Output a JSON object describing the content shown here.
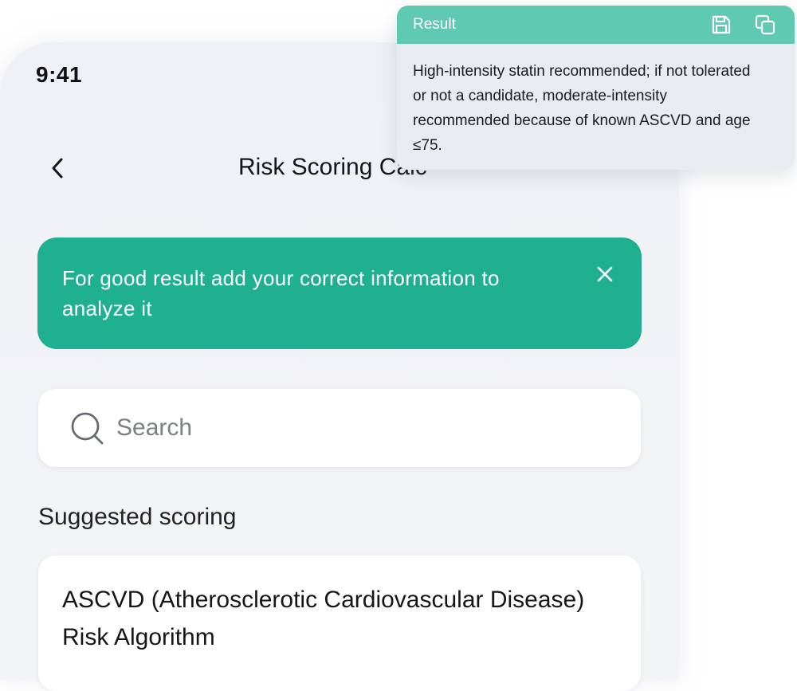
{
  "status_bar": {
    "time": "9:41"
  },
  "header": {
    "title": "Risk Scoring Calc",
    "back_icon": "chevron-left-icon"
  },
  "banner": {
    "text": "For good result add your correct information to analyze it",
    "close_icon": "close-icon",
    "color": "#1fb092"
  },
  "search": {
    "placeholder": "Search",
    "value": "",
    "icon": "search-icon"
  },
  "suggested": {
    "title": "Suggested scoring",
    "items": [
      {
        "label": "ASCVD (Atherosclerotic Cardiovascular Disease) Risk Algorithm"
      }
    ]
  },
  "result": {
    "title": "Result",
    "text": "High-intensity statin recommended; if not tolerated or not a candidate, moderate-intensity recommended because of known ASCVD and age ≤75.",
    "save_icon": "save-icon",
    "copy_icon": "copy-icon",
    "header_color": "#60c9b1"
  }
}
